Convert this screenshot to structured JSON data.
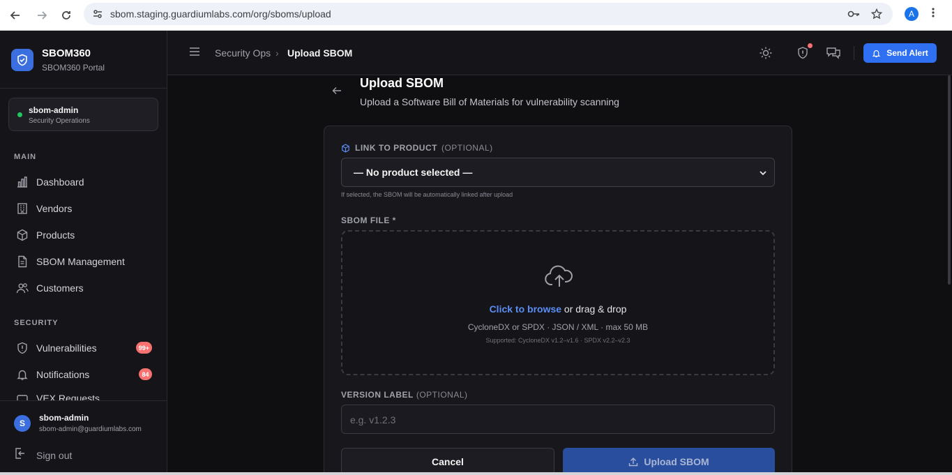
{
  "browser": {
    "url": "sbom.staging.guardiumlabs.com/org/sboms/upload",
    "profile_initial": "A"
  },
  "brand": {
    "name": "SBOM360",
    "subtitle": "SBOM360 Portal"
  },
  "org": {
    "name": "sbom-admin",
    "role": "Security Operations"
  },
  "sidebar": {
    "main_label": "MAIN",
    "main_items": [
      {
        "label": "Dashboard",
        "icon": "bar-chart-icon"
      },
      {
        "label": "Vendors",
        "icon": "building-icon"
      },
      {
        "label": "Products",
        "icon": "box-icon"
      },
      {
        "label": "SBOM Management",
        "icon": "file-icon"
      },
      {
        "label": "Customers",
        "icon": "users-icon"
      }
    ],
    "security_label": "SECURITY",
    "security_items": [
      {
        "label": "Vulnerabilities",
        "icon": "shield-alert-icon",
        "badge": "99+"
      },
      {
        "label": "Notifications",
        "icon": "bell-icon",
        "badge": "84"
      },
      {
        "label": "VEX Requests",
        "icon": "message-icon"
      }
    ]
  },
  "user": {
    "initial": "S",
    "name": "sbom-admin",
    "email": "sbom-admin@guardiumlabs.com",
    "signout_label": "Sign out"
  },
  "header": {
    "breadcrumb_parent": "Security Ops",
    "breadcrumb_separator": "›",
    "breadcrumb_current": "Upload SBOM",
    "send_alert_label": "Send Alert"
  },
  "page": {
    "title": "Upload SBOM",
    "subtitle": "Upload a Software Bill of Materials for vulnerability scanning"
  },
  "form": {
    "product_label": "LINK TO PRODUCT",
    "product_optional": "(OPTIONAL)",
    "product_value": "— No product selected —",
    "product_hint": "If selected, the SBOM will be automatically linked after upload",
    "file_label": "SBOM FILE *",
    "drop_link": "Click to browse",
    "drop_rest": " or drag & drop",
    "drop_formats": "CycloneDX or SPDX · JSON / XML · max 50 MB",
    "drop_supported": "Supported: CycloneDX v1.2–v1.6 · SPDX v2.2–v2.3",
    "version_label": "VERSION LABEL",
    "version_optional": "(OPTIONAL)",
    "version_placeholder": "e.g. v1.2.3",
    "cancel_label": "Cancel",
    "upload_label": "Upload SBOM"
  },
  "colors": {
    "accent": "#2f6ff2",
    "badge": "#f87171",
    "online": "#22c55e",
    "link": "#5b8ef5"
  }
}
